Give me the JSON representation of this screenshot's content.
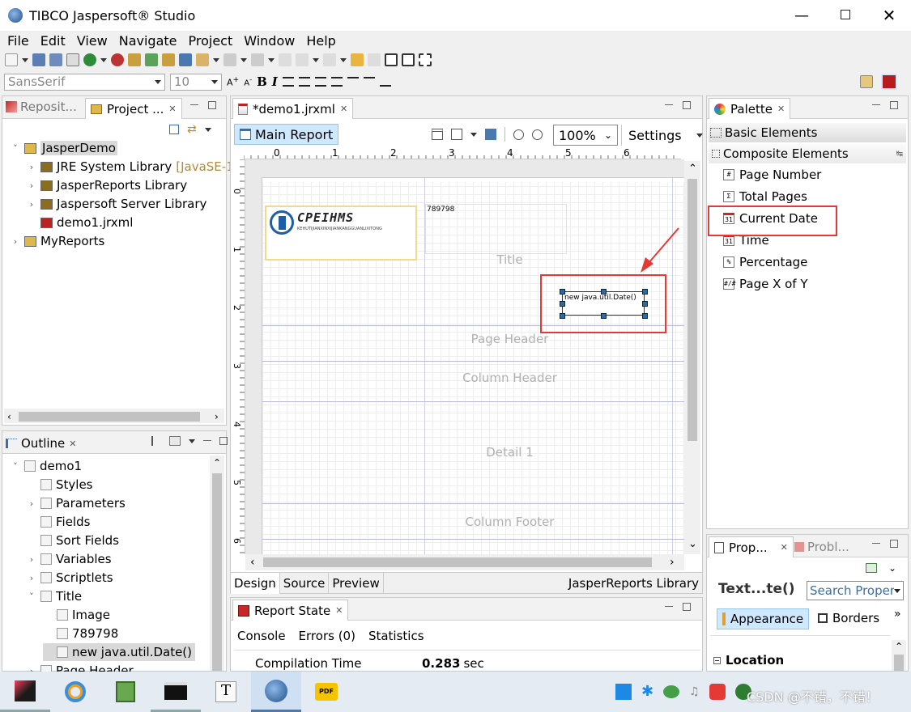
{
  "window": {
    "title": "TIBCO Jaspersoft® Studio"
  },
  "menu": [
    "File",
    "Edit",
    "View",
    "Navigate",
    "Project",
    "Window",
    "Help"
  ],
  "font_bar": {
    "family": "SansSerif",
    "size": "10"
  },
  "left_top": {
    "tabs": [
      "Reposit...",
      "Project ..."
    ],
    "tree": [
      {
        "label": "JasperDemo",
        "note": ""
      },
      {
        "label": "JRE System Library",
        "note": "[JavaSE-1."
      },
      {
        "label": "JasperReports Library",
        "note": ""
      },
      {
        "label": "Jaspersoft Server Library",
        "note": ""
      },
      {
        "label": "demo1.jrxml",
        "note": ""
      },
      {
        "label": "MyReports",
        "note": ""
      }
    ]
  },
  "outline": {
    "tab": "Outline",
    "items": [
      "demo1",
      "Styles",
      "Parameters",
      "Fields",
      "Sort Fields",
      "Variables",
      "Scriptlets",
      "Title",
      "Image",
      "789798",
      "new java.util.Date()",
      "Page Header"
    ]
  },
  "editor": {
    "tab": "*demo1.jrxml",
    "main_report": "Main Report",
    "zoom": "100%",
    "settings": "Settings",
    "ruler": [
      "0",
      "1",
      "2",
      "3",
      "4",
      "5",
      "6"
    ],
    "vruler": [
      "0",
      "1",
      "2",
      "3",
      "4",
      "5",
      "6"
    ],
    "logo_text": "CPEIHMS",
    "logo_sub": "KEHUTIJIANXINXIJIANKANGGUANLIXITONG",
    "static_text": "789798",
    "selected_field": "new java.util.Date()",
    "bands": [
      "Title",
      "Page Header",
      "Column Header",
      "Detail 1",
      "Column Footer"
    ],
    "bottom_tabs": [
      "Design",
      "Source",
      "Preview"
    ],
    "library": "JasperReports Library"
  },
  "report_state": {
    "tab": "Report State",
    "tabs": [
      "Console",
      "Errors (0)",
      "Statistics"
    ],
    "row_label": "Compilation Time",
    "row_value": "0.283",
    "row_unit": "sec"
  },
  "palette": {
    "tab": "Palette",
    "groups": [
      "Basic Elements",
      "Composite Elements"
    ],
    "items": [
      {
        "icon": "#",
        "label": "Page Number"
      },
      {
        "icon": "Σ",
        "label": "Total Pages"
      },
      {
        "icon": "31",
        "label": "Current Date"
      },
      {
        "icon": "31",
        "label": "Time"
      },
      {
        "icon": "%",
        "label": "Percentage"
      },
      {
        "icon": "#/#",
        "label": "Page X of Y"
      }
    ]
  },
  "properties": {
    "tabs": [
      "Prop...",
      "Probl..."
    ],
    "element": "Text...te()",
    "search_placeholder": "Search Proper",
    "sub_tabs": [
      "Appearance",
      "Borders"
    ],
    "section": "Location"
  },
  "watermark": "CSDN @不错，不错！",
  "colors": {
    "highlight_red": "#e53935",
    "selection_blue": "#cde8ff",
    "logo_blue": "#1e5ea8"
  }
}
